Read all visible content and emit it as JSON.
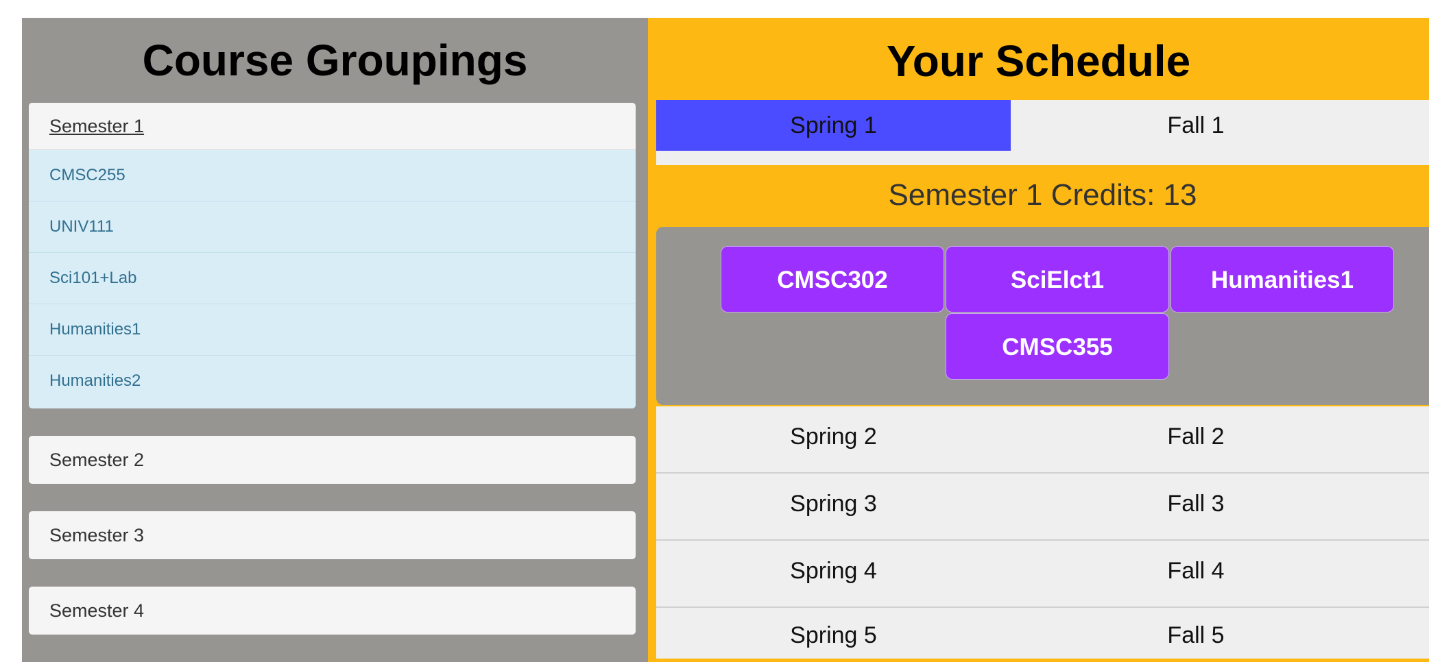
{
  "groupings": {
    "title": "Course Groupings",
    "open_semester": {
      "label": "Semester 1",
      "courses": [
        "CMSC255",
        "UNIV111",
        "Sci101+Lab",
        "Humanities1",
        "Humanities2"
      ]
    },
    "collapsed_semesters": [
      "Semester 2",
      "Semester 3",
      "Semester 4"
    ]
  },
  "schedule": {
    "title": "Your Schedule",
    "tabs": [
      {
        "label": "Spring 1",
        "active": true
      },
      {
        "label": "Fall 1",
        "active": false
      }
    ],
    "credits_text": "Semester 1 Credits: 13",
    "courses": [
      "CMSC302",
      "SciElct1",
      "Humanities1",
      "CMSC355"
    ],
    "rows": [
      {
        "spring": "Spring 2",
        "fall": "Fall 2"
      },
      {
        "spring": "Spring 3",
        "fall": "Fall 3"
      },
      {
        "spring": "Spring 4",
        "fall": "Fall 4"
      },
      {
        "spring": "Spring 5",
        "fall": "Fall 5"
      }
    ]
  },
  "colors": {
    "left_bg": "#979591",
    "right_bg": "#fdb813",
    "active_tab": "#4b4bff",
    "course_chip": "#9b30ff",
    "list_item_bg": "#d9edf7",
    "list_item_text": "#31708f"
  }
}
